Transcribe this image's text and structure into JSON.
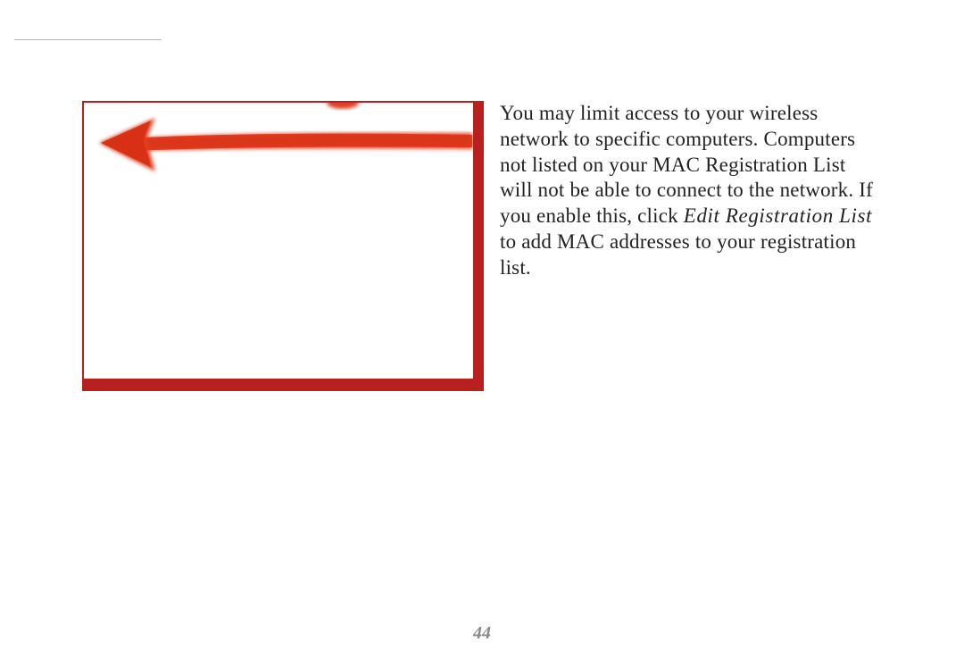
{
  "body": {
    "text_before_italic": "You may limit access to your wireless network to specific computers. Computers not listed on your MAC Registration List will not be able to connect to the network.  If you enable this, click ",
    "italic_text": "Edit Registration List",
    "text_after_italic": " to add MAC addresses to your registration list."
  },
  "page_number": "44",
  "colors": {
    "frame_border": "#b82020",
    "arrow": "#e03618"
  }
}
